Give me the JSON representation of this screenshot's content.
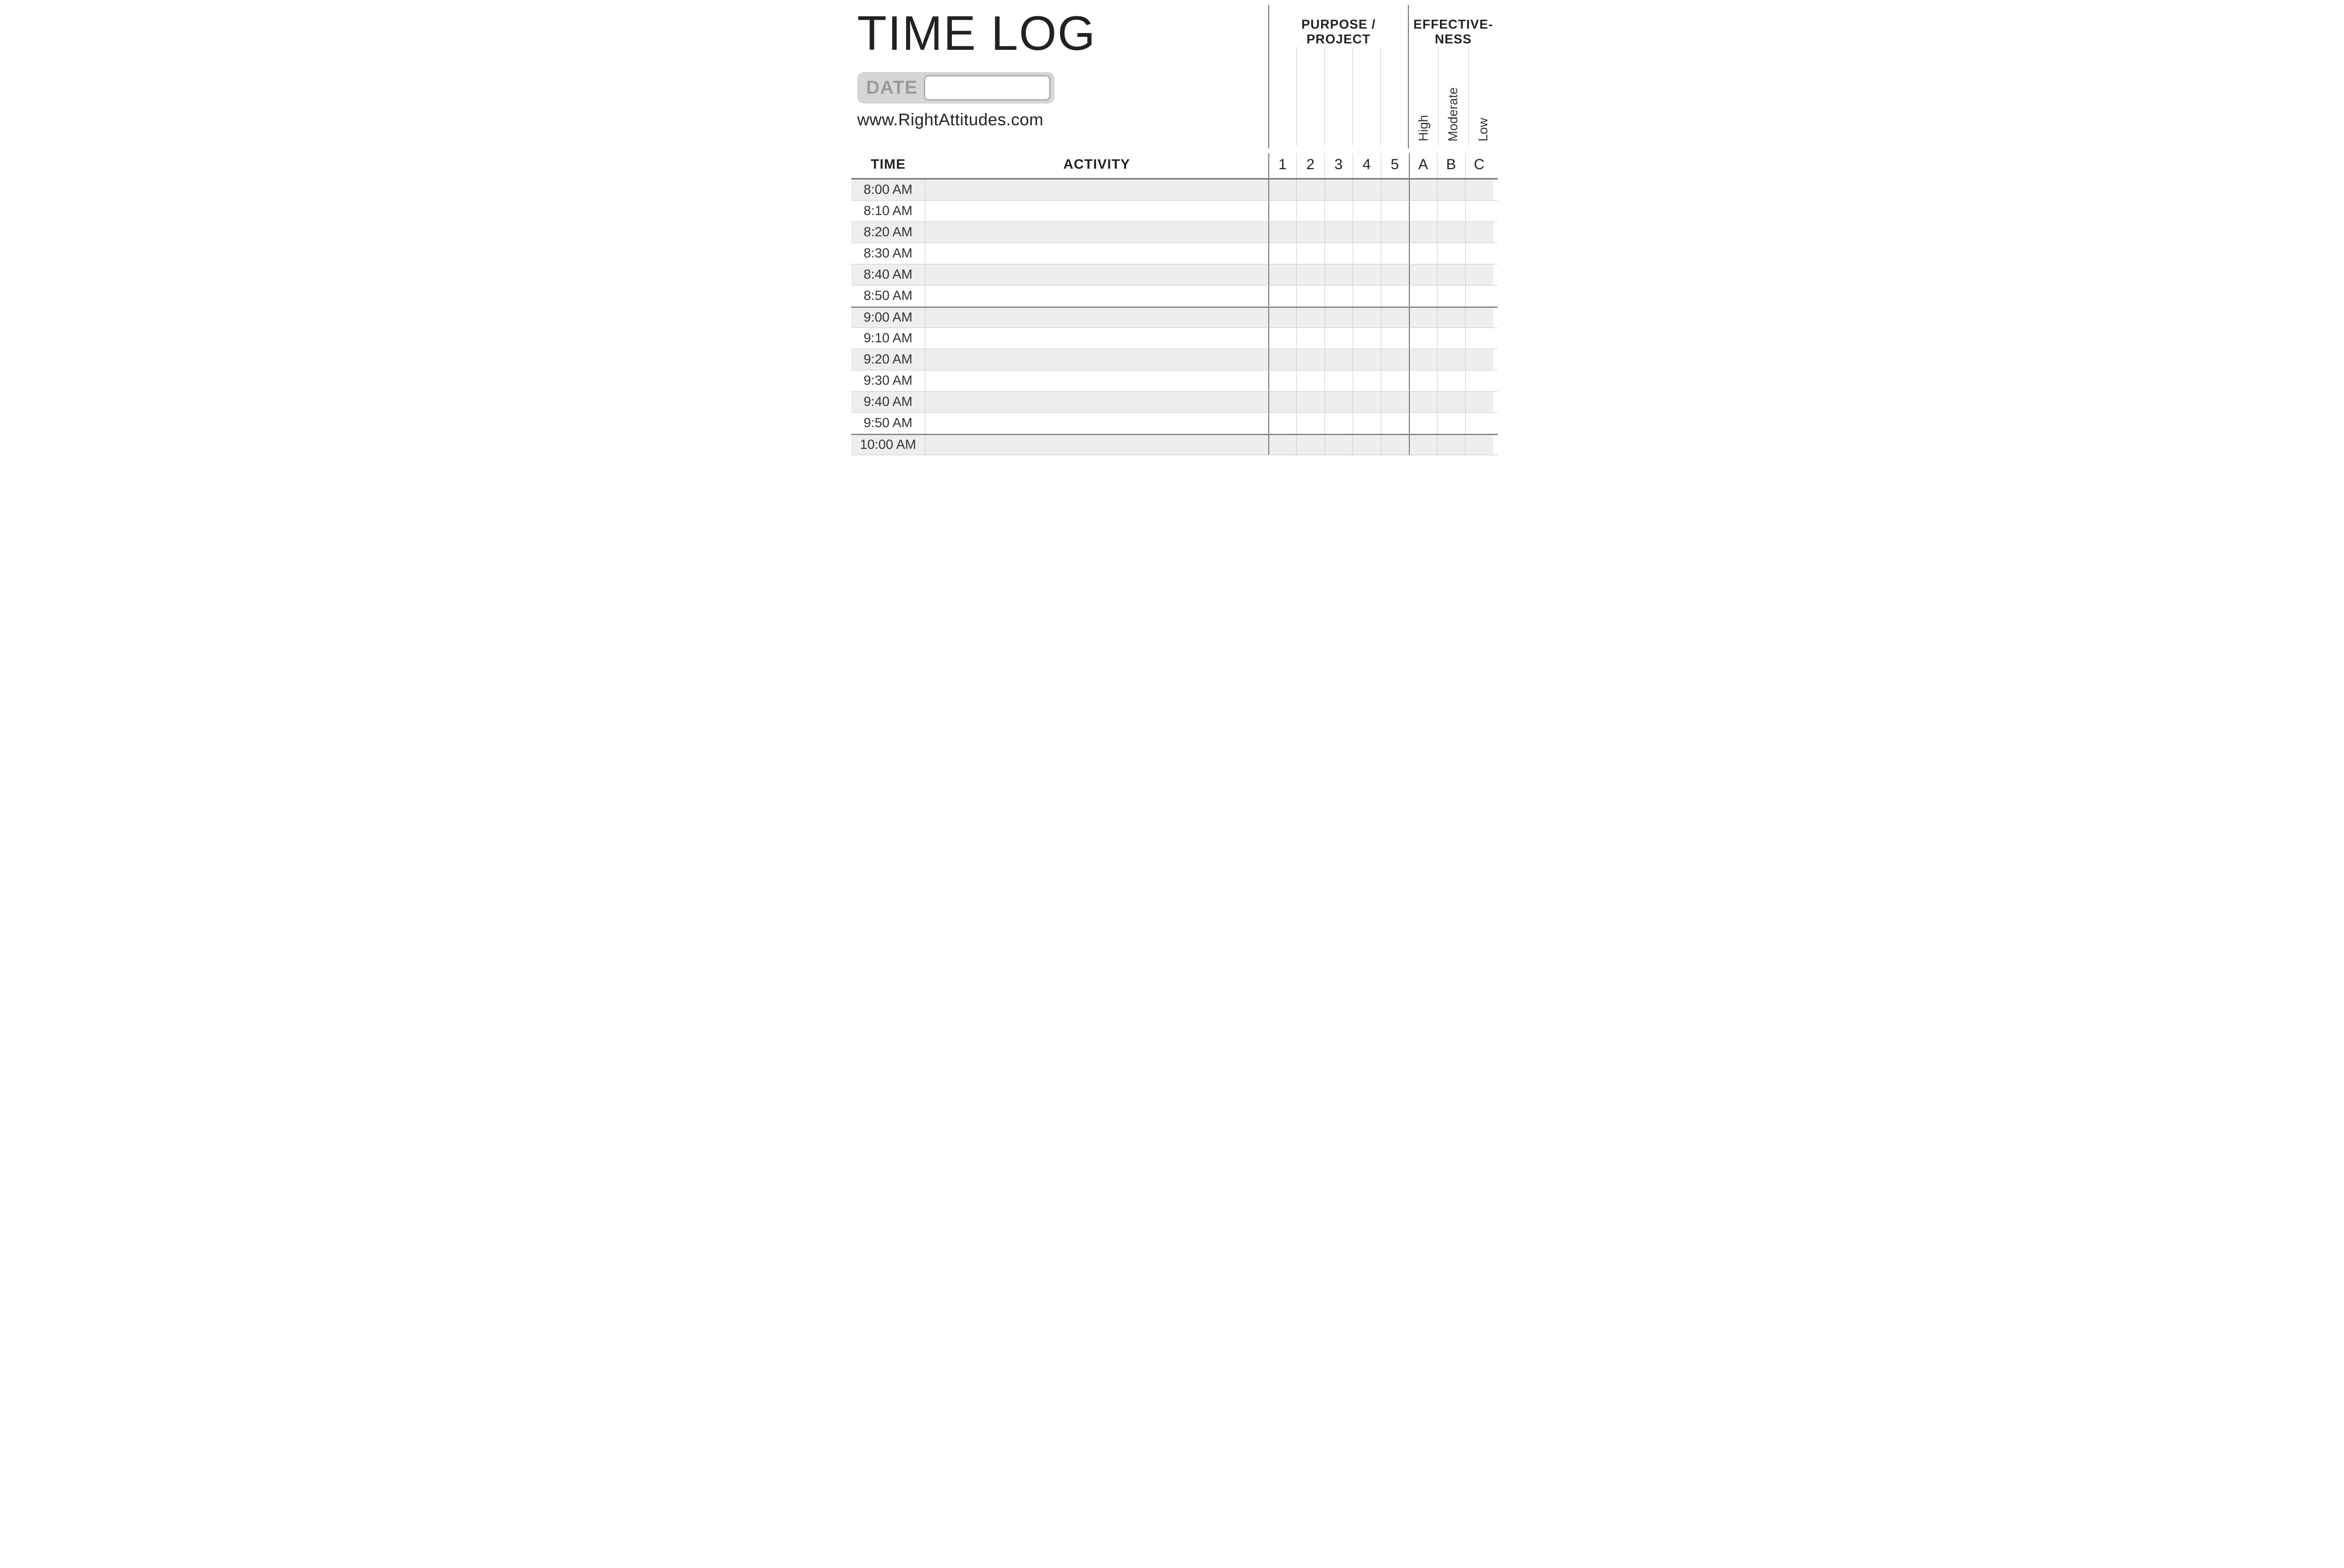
{
  "title": "TIME LOG",
  "date_label": "DATE",
  "date_value": "",
  "site_url": "www.RightAttitudes.com",
  "purpose_header": "PURPOSE / PROJECT",
  "effectiveness_header": "EFFECTIVE-\nNESS",
  "effectiveness_labels": [
    "High",
    "Moderate",
    "Low"
  ],
  "col_time_label": "TIME",
  "col_activity_label": "ACTIVITY",
  "purpose_numbers": [
    "1",
    "2",
    "3",
    "4",
    "5"
  ],
  "effectiveness_letters": [
    "A",
    "B",
    "C"
  ],
  "rows": [
    {
      "time": "8:00 AM",
      "shade": true,
      "hour_start": false
    },
    {
      "time": "8:10 AM",
      "shade": false,
      "hour_start": false
    },
    {
      "time": "8:20 AM",
      "shade": true,
      "hour_start": false
    },
    {
      "time": "8:30 AM",
      "shade": false,
      "hour_start": false
    },
    {
      "time": "8:40 AM",
      "shade": true,
      "hour_start": false
    },
    {
      "time": "8:50 AM",
      "shade": false,
      "hour_start": false
    },
    {
      "time": "9:00 AM",
      "shade": true,
      "hour_start": true
    },
    {
      "time": "9:10 AM",
      "shade": false,
      "hour_start": false
    },
    {
      "time": "9:20 AM",
      "shade": true,
      "hour_start": false
    },
    {
      "time": "9:30 AM",
      "shade": false,
      "hour_start": false
    },
    {
      "time": "9:40 AM",
      "shade": true,
      "hour_start": false
    },
    {
      "time": "9:50 AM",
      "shade": false,
      "hour_start": false
    },
    {
      "time": "10:00 AM",
      "shade": true,
      "hour_start": true
    }
  ]
}
